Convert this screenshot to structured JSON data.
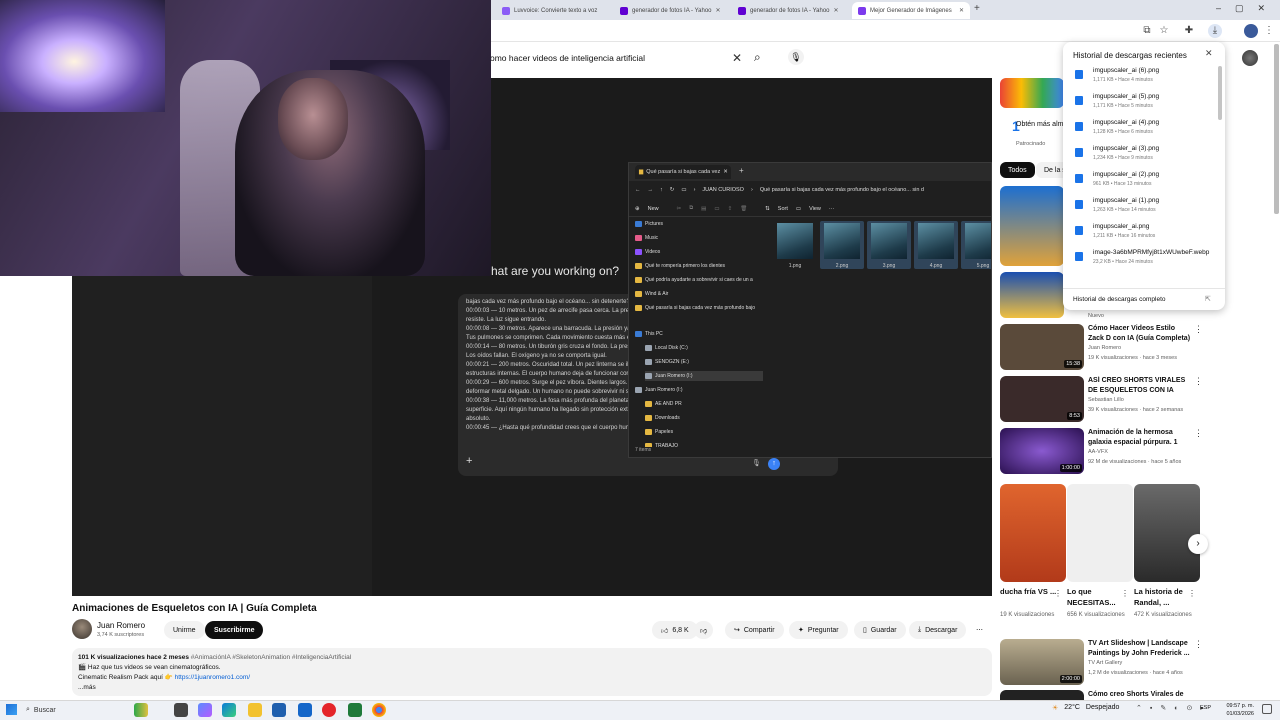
{
  "browser": {
    "tabs": [
      {
        "title": "Luvvoice: Convierte texto a voz",
        "color": "#8b5cf6"
      },
      {
        "title": "generador de fotos IA - Yahoo",
        "color": "#6001d2"
      },
      {
        "title": "generador de fotos IA - Yahoo",
        "color": "#6001d2"
      },
      {
        "title": "Mejor Generador de Imágenes",
        "color": "#7c3aed"
      }
    ],
    "new_tab": "+"
  },
  "youtube": {
    "search_query": "omo hacer videos de inteligencia artificial"
  },
  "player": {
    "prompt_heading": "hat are you working on?",
    "transcript": [
      "bajas cada vez más profundo bajo el océano... sin detenerte?",
      "00:00:03 — 10 metros.  Un pez de arrecife pasa cerca.  La presión apenas se si",
      "resiste.  La luz sigue entrando.",
      "00:00:08 — 30 metros.  Aparece una barracuda.  La presión ya es 4 veces may",
      "Tus pulmones se comprimen.  Cada movimiento cuesta más energía.",
      "00:00:14 — 80 metros.  Un tiburón gris cruza el fondo.  La presión aplasta el a",
      "Los oídos fallan.  El oxígeno ya no se comporta igual.",
      "00:00:21 — 200 metros.  Oscuridad total.  Un pez linterna se ilumina solo.  Aq",
      "estructuras internas.  El cuerpo humano deja de funcionar correctamente.",
      "00:00:29 — 600 metros.  Surge el pez víbora.  Dientes largos.  Cero luz.  La pr",
      "deformar metal delgado.  Un humano no puede sobrevivir ni segundos.",
      "00:00:38 — 11,000 metros.  La fosa más profunda del planeta.  Más de mil vec",
      "superficie.  Aquí ningún humano ha llegado sin protección extrema.  Solo mác",
      "absoluto.",
      "00:00:45 — ¿Hasta qué profundidad crees que el cuerpo humano podría resi"
    ]
  },
  "explorer": {
    "tab_title": "Qué pasaría si bajas cada vez",
    "breadcrumb": [
      "JUAN CURIOSO",
      "Qué pasaría si bajas cada vez más profundo bajo el océano... sin d"
    ],
    "commands": [
      "New",
      "Sort",
      "View",
      "···"
    ],
    "sidebar": [
      {
        "label": "Pictures",
        "color": "#3a7bd5"
      },
      {
        "label": "Music",
        "color": "#e55b8a"
      },
      {
        "label": "Videos",
        "color": "#8c52ff"
      },
      {
        "label": "Qué te rompería primero los dientes",
        "color": "#e5b842"
      },
      {
        "label": "Qué podría ayudarte a sobrevivir si caes de un a",
        "color": "#e5b842"
      },
      {
        "label": "Wind & Air",
        "color": "#e5b842"
      },
      {
        "label": "Qué pasaría si bajas cada vez más profundo bajo",
        "color": "#e5b842"
      },
      {
        "label": "This PC",
        "color": "#3a7bd5"
      },
      {
        "label": "Local Disk (C:)",
        "color": "#9aa4b1"
      },
      {
        "label": "SENDGZN  (E:)",
        "color": "#9aa4b1"
      },
      {
        "label": "Juan Romero (I:)",
        "color": "#9aa4b1"
      },
      {
        "label": "Juan Romero (I:)",
        "color": "#9aa4b1"
      },
      {
        "label": "AE AND PR",
        "color": "#e5b842"
      },
      {
        "label": "Downloads",
        "color": "#e5b842"
      },
      {
        "label": "Papeles",
        "color": "#e5b842"
      },
      {
        "label": "TRABAJO",
        "color": "#e5b842"
      }
    ],
    "files": [
      "1.png",
      "2.png",
      "3.png",
      "4.png",
      "5.png"
    ],
    "status": "7 items"
  },
  "video": {
    "title": "Animaciones de Esqueletos con IA | Guía Completa",
    "channel": "Juan Romero",
    "subscribers": "3,74 K suscriptores",
    "join_label": "Unirme",
    "subscribe_label": "Suscribirme",
    "likes": "6,8 K",
    "share_label": "Compartir",
    "ask_label": "Preguntar",
    "save_label": "Guardar",
    "download_label": "Descargar",
    "description": {
      "stats": "101 K visualizaciones  hace 2 meses",
      "tags": "#AnimaciónIA #SkeletonAnimation #InteligenciaArtificial",
      "line1": "🎬 Haz que tus videos se vean cinematográficos.",
      "line2_prefix": "Cinematic Realism Pack aquí 👉 ",
      "link": "https://1juanromero1.com/",
      "more": "...más"
    }
  },
  "sidebar_right": {
    "ad": {
      "text": "Obtén más almacenamiento",
      "sponsor": "Patrocinado"
    },
    "chips": [
      "Todos",
      "De la s"
    ],
    "videos": [
      {
        "title": "Cómo Hacer Videos Estilo Zack D con IA (Guía Completa)",
        "channel": "Juan Romero",
        "meta": "19 K visualizaciones · hace 3 meses",
        "duration": "15:38",
        "color": "#5a4a3a"
      },
      {
        "title": "ASÍ CREO SHORTS VIRALES DE ESQUELETOS CON IA (GRATIS)",
        "channel": "Sebastian Lillo",
        "meta": "39 K visualizaciones · hace 2 semanas",
        "duration": "8:53",
        "color": "#3a2a2a"
      },
      {
        "title": "Animación de la hermosa galaxia espacial púrpura. 1 hor...",
        "channel": "AA-VFX",
        "meta": "92 M de visualizaciones · hace 5 años",
        "duration": "1:00:00",
        "color": "#4b2a8a"
      }
    ],
    "partial_label": "Nuevo",
    "shorts": [
      {
        "title": "ducha fría VS ...",
        "views": "19 K visualizaciones",
        "color": "#d9582b"
      },
      {
        "title": "Lo que NECESITAS...",
        "views": "656 K visualizaciones",
        "color": "#e8e8e8"
      },
      {
        "title": "La historia de Randal, ...",
        "views": "472 K visualizaciones",
        "color": "#4a4a4a"
      }
    ],
    "more_videos": [
      {
        "title": "TV Art Slideshow | Landscape Paintings by John Frederick ...",
        "channel": "TV Art Gallery",
        "meta": "1,2 M de visualizaciones · hace 4 años",
        "duration": "2:00:00",
        "color": "#8a7f6a"
      },
      {
        "title": "Cómo creo Shorts Virales de",
        "channel": "",
        "meta": "",
        "duration": "",
        "color": "#222"
      }
    ]
  },
  "downloads": {
    "title": "Historial de descargas recientes",
    "items": [
      {
        "name": "imgupscaler_ai (6).png",
        "meta": "1,171 KB • Hace 4 minutos"
      },
      {
        "name": "imgupscaler_ai (5).png",
        "meta": "1,171 KB • Hace 5 minutos"
      },
      {
        "name": "imgupscaler_ai (4).png",
        "meta": "1,128 KB • Hace 6 minutos"
      },
      {
        "name": "imgupscaler_ai (3).png",
        "meta": "1,234 KB • Hace 9 minutos"
      },
      {
        "name": "imgupscaler_ai (2).png",
        "meta": "961 KB • Hace 13 minutos"
      },
      {
        "name": "imgupscaler_ai (1).png",
        "meta": "1,263 KB • Hace 14 minutos"
      },
      {
        "name": "imgupscaler_ai.png",
        "meta": "1,211 KB • Hace 16 minutos"
      },
      {
        "name": "image-3a6bMPRMfyj8t1xWUwbeF.webp",
        "meta": "23,2 KB • Hace 24 minutos"
      }
    ],
    "full_history": "Historial de descargas completo"
  },
  "taskbar": {
    "search_placeholder": "Buscar",
    "weather": "22°C",
    "weather_desc": "Despejado",
    "lang": "ESP",
    "time": "09:57 p. m.",
    "date": "01/03/2026"
  }
}
